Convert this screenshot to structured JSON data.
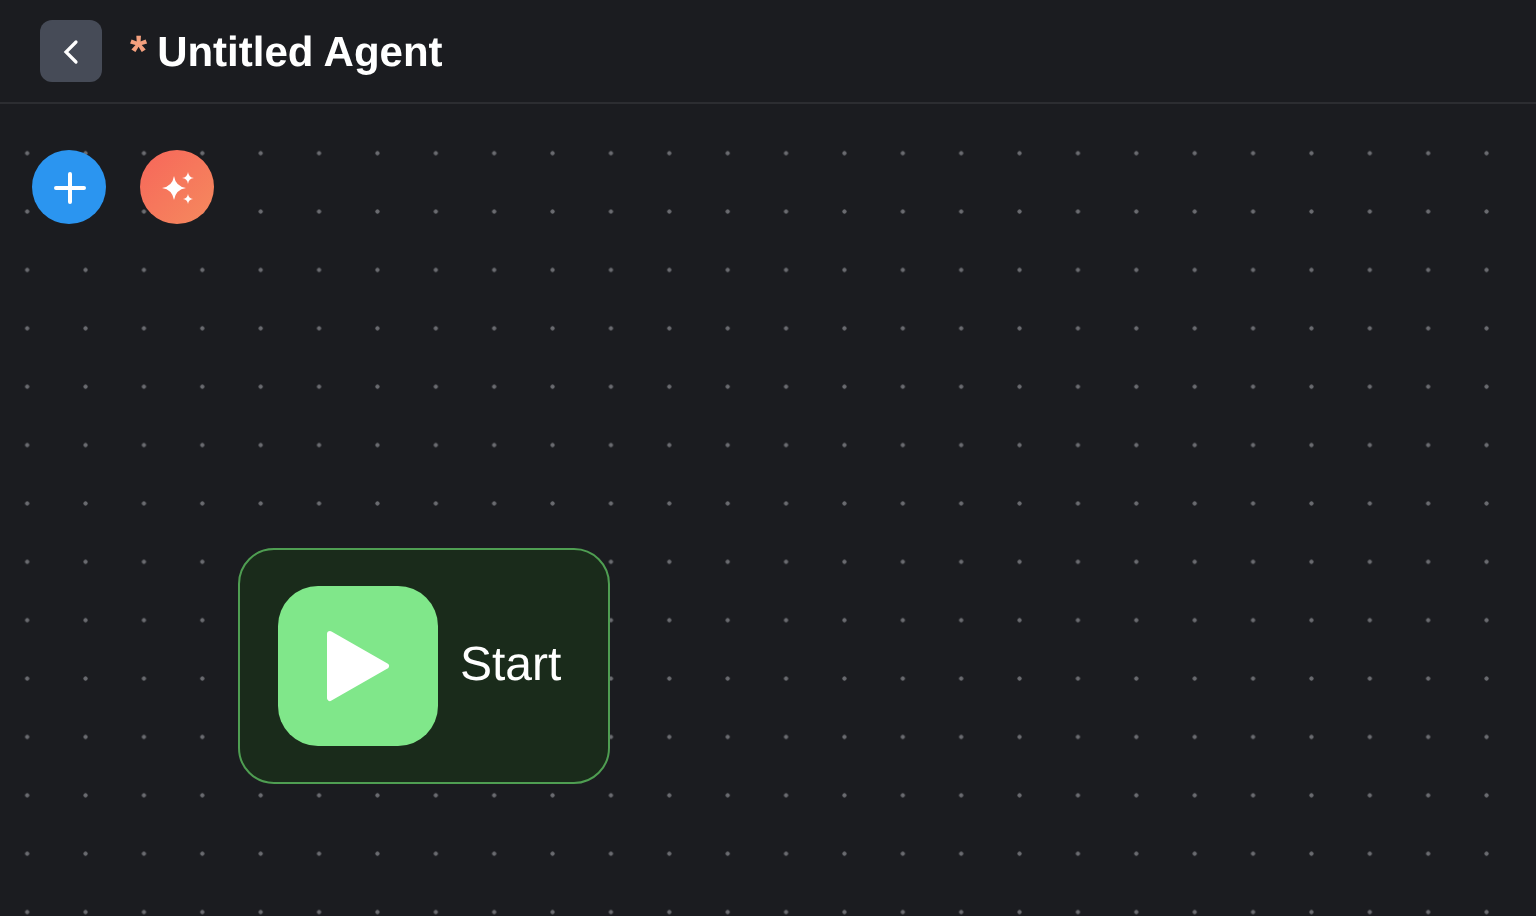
{
  "header": {
    "unsaved_marker": "*",
    "title": "Untitled Agent"
  },
  "canvas": {
    "nodes": [
      {
        "kind": "start",
        "label": "Start"
      }
    ]
  }
}
